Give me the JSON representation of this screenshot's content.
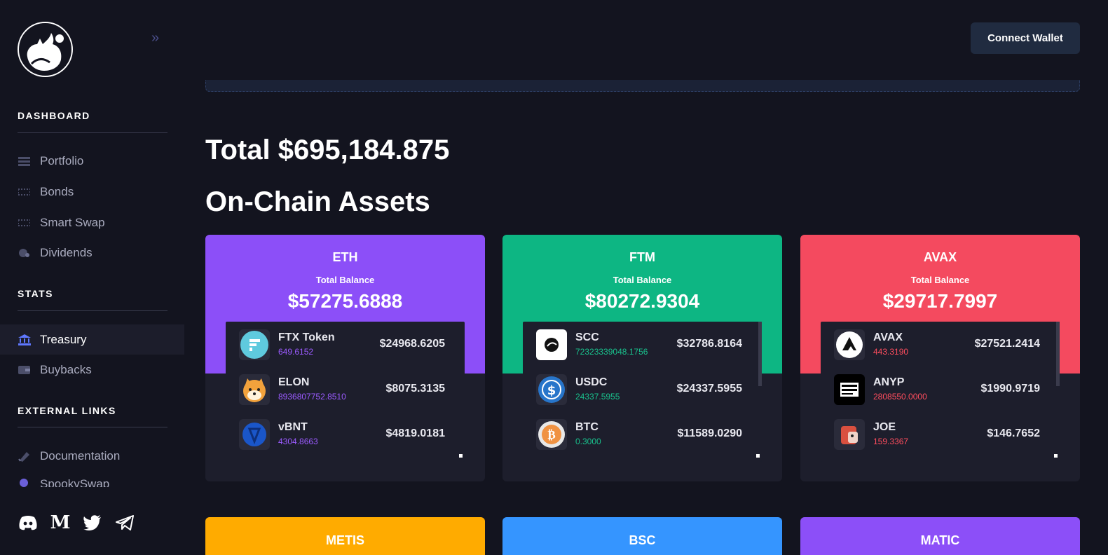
{
  "sidebar": {
    "sections": {
      "dashboard": "DASHBOARD",
      "stats": "STATS",
      "external": "EXTERNAL LINKS"
    },
    "items": [
      {
        "label": "Portfolio",
        "icon": "portfolio-icon"
      },
      {
        "label": "Bonds",
        "icon": "bonds-icon"
      },
      {
        "label": "Smart Swap",
        "icon": "swap-icon"
      },
      {
        "label": "Dividends",
        "icon": "dividends-icon"
      },
      {
        "label": "Treasury",
        "icon": "bank-icon"
      },
      {
        "label": "Buybacks",
        "icon": "wallet-icon"
      },
      {
        "label": "Documentation",
        "icon": "book-icon"
      },
      {
        "label": "SpookySwap",
        "icon": "spooky-icon"
      }
    ],
    "socials": [
      "discord-icon",
      "medium-icon",
      "twitter-icon",
      "telegram-icon"
    ]
  },
  "header": {
    "connect_label": "Connect Wallet"
  },
  "main": {
    "total": "Total $695,184.875",
    "onchain_title": "On-Chain Assets",
    "total_balance_label": "Total Balance"
  },
  "cards": [
    {
      "chain": "ETH",
      "balance": "$57275.6888",
      "color": "#8c4ff8",
      "amount_color": "#9b5bff",
      "tokens": [
        {
          "name": "FTX Token",
          "amount": "649.6152",
          "usd": "$24968.6205"
        },
        {
          "name": "ELON",
          "amount": "8936807752.8510",
          "usd": "$8075.3135"
        },
        {
          "name": "vBNT",
          "amount": "4304.8663",
          "usd": "$4819.0181"
        }
      ]
    },
    {
      "chain": "FTM",
      "balance": "$80272.9304",
      "color": "#0db683",
      "amount_color": "#19c28d",
      "tokens": [
        {
          "name": "SCC",
          "amount": "72323339048.1756",
          "usd": "$32786.8164"
        },
        {
          "name": "USDC",
          "amount": "24337.5955",
          "usd": "$24337.5955"
        },
        {
          "name": "BTC",
          "amount": "0.3000",
          "usd": "$11589.0290"
        }
      ]
    },
    {
      "chain": "AVAX",
      "balance": "$29717.7997",
      "color": "#f44a5f",
      "amount_color": "#ff4d5e",
      "tokens": [
        {
          "name": "AVAX",
          "amount": "443.3190",
          "usd": "$27521.2414"
        },
        {
          "name": "ANYP",
          "amount": "2808550.0000",
          "usd": "$1990.9719"
        },
        {
          "name": "JOE",
          "amount": "159.3367",
          "usd": "$146.7652"
        }
      ]
    }
  ],
  "bottom_cards": [
    {
      "chain": "METIS",
      "color": "#ffab00"
    },
    {
      "chain": "BSC",
      "color": "#3595ff"
    },
    {
      "chain": "MATIC",
      "color": "#8c4ff8"
    }
  ]
}
